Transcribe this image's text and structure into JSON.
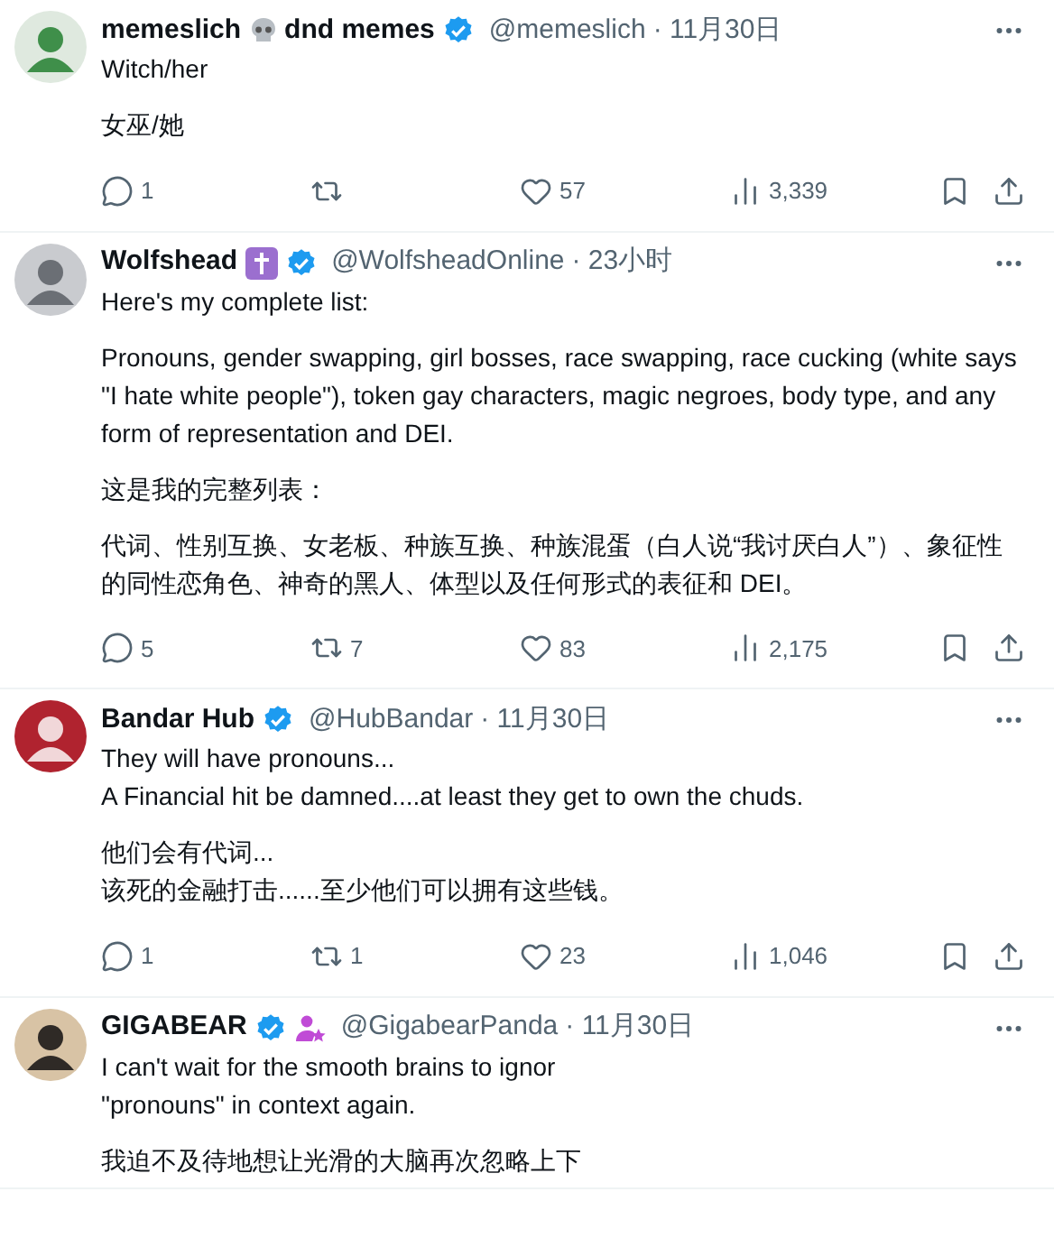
{
  "tweets": [
    {
      "name_parts": [
        {
          "kind": "text",
          "text": "memeslich"
        },
        {
          "kind": "skull"
        },
        {
          "kind": "text",
          "text": "dnd memes"
        },
        {
          "kind": "verified"
        }
      ],
      "handle": "@memeslich",
      "time": "· 11月30日",
      "paragraphs": [
        [
          "Witch/her"
        ],
        [
          "女巫/她"
        ]
      ],
      "replies": "1",
      "likes": "57",
      "views": "3,339"
    },
    {
      "name_parts": [
        {
          "kind": "text",
          "text": "Wolfshead"
        },
        {
          "kind": "cross"
        },
        {
          "kind": "verified"
        }
      ],
      "handle": "@WolfsheadOnline",
      "time": "· 23小时",
      "paragraphs": [
        [
          "Here's my complete list:"
        ],
        [
          "Pronouns, gender swapping, girl bosses, race swapping, race cucking (white says \"I hate white people\"), token gay characters, magic negroes, body type, and any form of representation and DEI."
        ],
        [
          "这是我的完整列表："
        ],
        [
          "代词、性别互换、女老板、种族互换、种族混蛋（白人说“我讨厌白人”）、象征性的同性恋角色、神奇的黑人、体型以及任何形式的表征和 DEI。"
        ]
      ],
      "replies": "5",
      "retweets": "7",
      "likes": "83",
      "views": "2,175"
    },
    {
      "name_parts": [
        {
          "kind": "text",
          "text": "Bandar Hub"
        },
        {
          "kind": "verified"
        }
      ],
      "handle": "@HubBandar",
      "time": "· 11月30日",
      "paragraphs": [
        [
          "They will have pronouns...",
          "A Financial hit be damned....at least they get to own the chuds."
        ],
        [
          "他们会有代词...",
          "该死的金融打击......至少他们可以拥有这些钱。"
        ]
      ],
      "replies": "1",
      "retweets": "1",
      "likes": "23",
      "views": "1,046"
    },
    {
      "name_parts": [
        {
          "kind": "text",
          "text": "GIGABEAR"
        },
        {
          "kind": "verified"
        },
        {
          "kind": "person-star"
        }
      ],
      "handle": "@GigabearPanda",
      "time": "· 11月30日",
      "paragraphs": [
        [
          "I can't wait for the smooth brains to ignor",
          "\"pronouns\" in context again."
        ],
        [
          "我迫不及待地想让光滑的大脑再次忽略上下"
        ]
      ]
    }
  ]
}
